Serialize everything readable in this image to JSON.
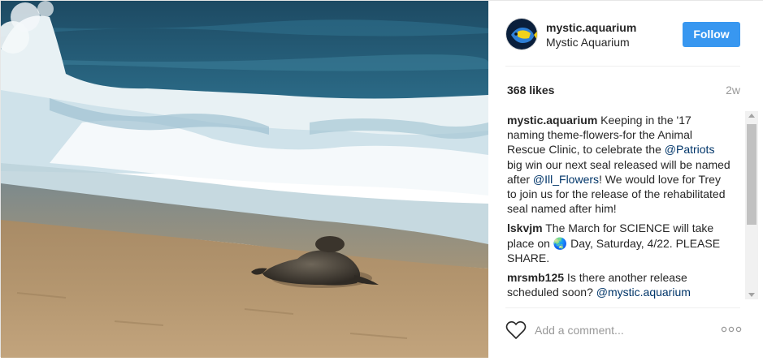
{
  "post": {
    "image_description_icon": "photo",
    "account": {
      "username": "mystic.aquarium",
      "full_name": "Mystic Aquarium",
      "avatar_icon": "fish-avatar-icon"
    },
    "follow_label": "Follow",
    "likes": "368 likes",
    "age": "2w",
    "comments": [
      {
        "user": "mystic.aquarium",
        "parts": [
          {
            "text": " Keeping in the '17 naming theme-flowers-for the Animal Rescue Clinic, to celebrate the "
          },
          {
            "text": "@Patriots",
            "mention": true
          },
          {
            "text": " big win our next seal released will be named after "
          },
          {
            "text": "@Ill_Flowers",
            "mention": true
          },
          {
            "text": "! We would love for Trey to join us for the release of the rehabilitated seal named after him!"
          }
        ]
      },
      {
        "user": "lskvjm",
        "parts": [
          {
            "text": " The March for SCIENCE will take place on 🌏 Day, Saturday, 4/22. PLEASE SHARE."
          }
        ]
      },
      {
        "user": "mrsmb125",
        "parts": [
          {
            "text": " Is there another release scheduled soon? "
          },
          {
            "text": "@mystic.aquarium",
            "mention": true
          }
        ]
      }
    ],
    "add_comment_placeholder": "Add a comment...",
    "colors": {
      "follow_button": "#3897f0",
      "mention": "#003569",
      "muted_text": "#999999"
    },
    "icons": {
      "like": "heart-icon",
      "options": "more-options-icon"
    }
  }
}
